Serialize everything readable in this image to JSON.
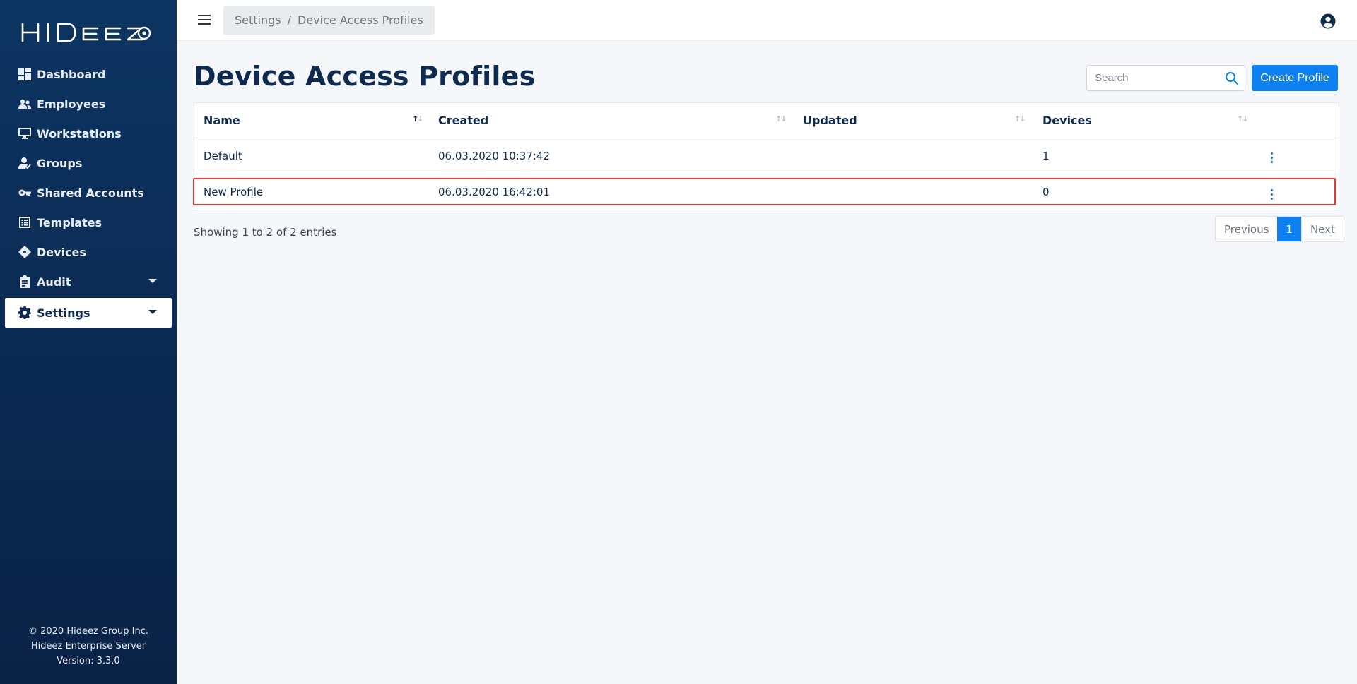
{
  "sidebar": {
    "logo_text": "HIDEEZ",
    "items": [
      {
        "label": "Dashboard",
        "icon": "dashboard-icon"
      },
      {
        "label": "Employees",
        "icon": "employees-icon"
      },
      {
        "label": "Workstations",
        "icon": "monitor-icon"
      },
      {
        "label": "Groups",
        "icon": "groups-icon"
      },
      {
        "label": "Shared Accounts",
        "icon": "key-icon"
      },
      {
        "label": "Templates",
        "icon": "templates-icon"
      },
      {
        "label": "Devices",
        "icon": "device-icon"
      },
      {
        "label": "Audit",
        "icon": "clipboard-icon",
        "has_submenu": true
      },
      {
        "label": "Settings",
        "icon": "gear-icon",
        "has_submenu": true,
        "active": true
      }
    ],
    "footer": {
      "copyright": "© 2020 Hideez Group Inc.",
      "product": "Hideez Enterprise Server",
      "version": "Version: 3.3.0"
    }
  },
  "header": {
    "breadcrumb": [
      "Settings",
      "Device Access Profiles"
    ],
    "breadcrumb_sep": "/"
  },
  "main": {
    "title": "Device Access Profiles",
    "search_placeholder": "Search",
    "create_button": "Create Profile",
    "table": {
      "columns": [
        "Name",
        "Created",
        "Updated",
        "Devices"
      ],
      "rows": [
        {
          "name": "Default",
          "created": "06.03.2020 10:37:42",
          "updated": "",
          "devices": "1"
        },
        {
          "name": "New Profile",
          "created": "06.03.2020 16:42:01",
          "updated": "",
          "devices": "0"
        }
      ],
      "highlighted_row": 1
    },
    "info": "Showing 1 to 2 of 2 entries",
    "pagination": {
      "previous": "Previous",
      "current": "1",
      "next": "Next"
    }
  },
  "colors": {
    "sidebar_bg": "#0d3462",
    "accent": "#0d80f2",
    "highlight": "#e53535"
  }
}
